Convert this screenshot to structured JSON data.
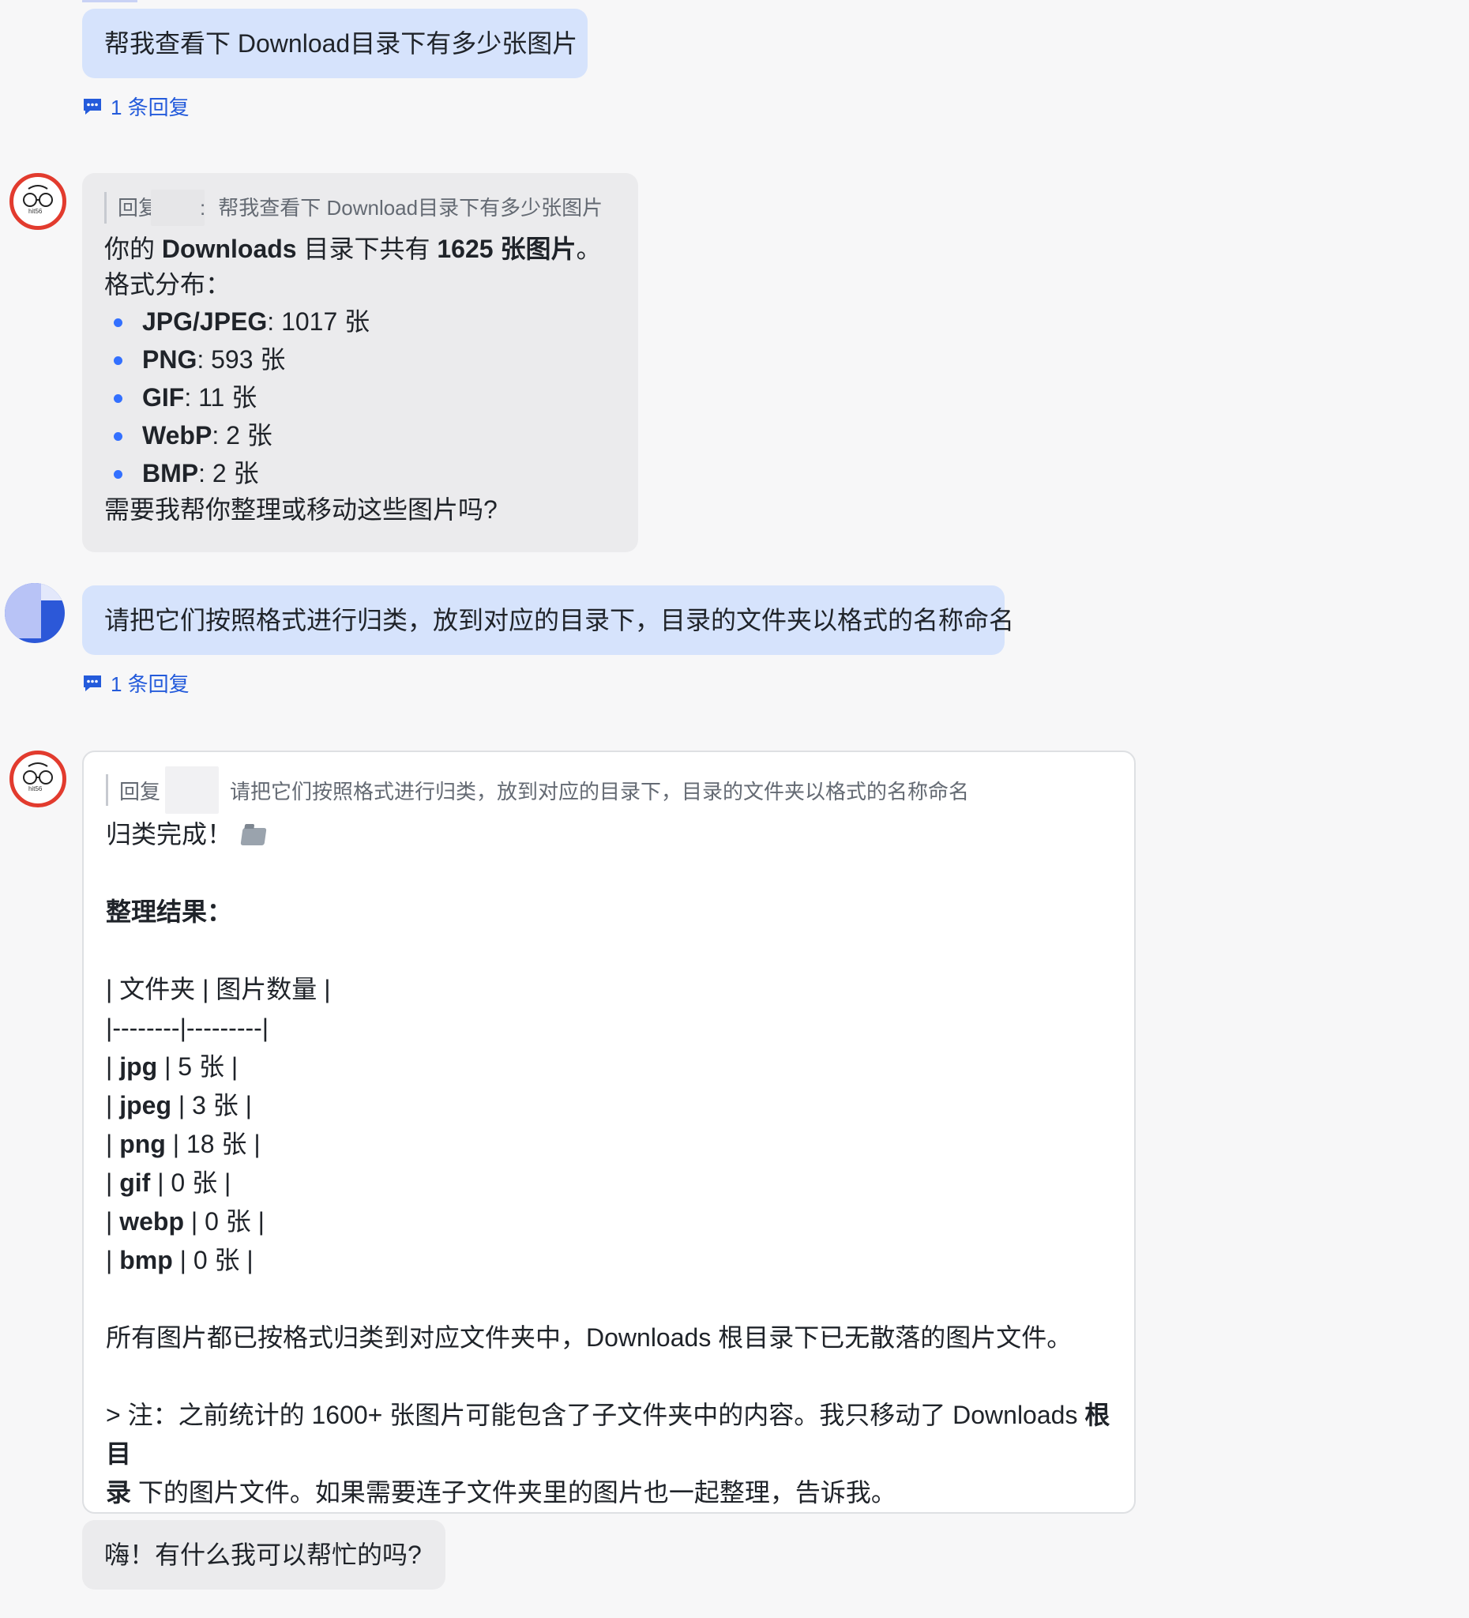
{
  "messages": {
    "m1": {
      "text": "帮我查看下 Download目录下有多少张图片",
      "reply_count": "1 条回复"
    },
    "m2": {
      "avatar_label": "hit56",
      "quote_prefix": "回复",
      "quote_sep": ":",
      "quote_text": "帮我查看下 Download目录下有多少张图片",
      "line1_pre": "你的 ",
      "line1_b1": "Downloads",
      "line1_mid": " 目录下共有 ",
      "line1_b2": "1625 张图片",
      "line1_post": "。",
      "line2": "格式分布：",
      "formats": [
        {
          "name": "JPG/JPEG",
          "count": ": 1017 张"
        },
        {
          "name": "PNG",
          "count": ": 593 张"
        },
        {
          "name": "GIF",
          "count": ": 11 张"
        },
        {
          "name": "WebP",
          "count": ": 2 张"
        },
        {
          "name": "BMP",
          "count": ": 2 张"
        }
      ],
      "closing": "需要我帮你整理或移动这些图片吗?"
    },
    "m3": {
      "text": "请把它们按照格式进行归类，放到对应的目录下，目录的文件夹以格式的名称命名",
      "reply_count": "1 条回复"
    },
    "m4": {
      "avatar_label": "hit56",
      "quote_prefix": "回复",
      "quote_text": "请把它们按照格式进行归类，放到对应的目录下，目录的文件夹以格式的名称命名",
      "done": "归类完成！",
      "folder_icon": "folder-icon",
      "result_title": "整理结果：",
      "table_header": "| 文件夹 | 图片数量 |",
      "table_sep": "|--------|---------|",
      "rows": [
        {
          "pre": "| ",
          "name": "jpg",
          "post": " | 5 张 |"
        },
        {
          "pre": "| ",
          "name": "jpeg",
          "post": " | 3 张 |"
        },
        {
          "pre": "| ",
          "name": "png",
          "post": " | 18 张 |"
        },
        {
          "pre": "| ",
          "name": "gif",
          "post": " | 0 张 |"
        },
        {
          "pre": "| ",
          "name": "webp",
          "post": " | 0 张 |"
        },
        {
          "pre": "| ",
          "name": "bmp",
          "post": " | 0 张 |"
        }
      ],
      "summary": "所有图片都已按格式归类到对应文件夹中，Downloads 根目录下已无散落的图片文件。",
      "note_pre": "> 注：之前统计的 1600+ 张图片可能包含了子文件夹中的内容。我只移动了 Downloads ",
      "note_b1": "根目",
      "note_b2": "录",
      "note_post": " 下的图片文件。如果需要连子文件夹里的图片也一起整理，告诉我。"
    },
    "m5": {
      "text": "嗨！有什么我可以帮忙的吗?"
    }
  },
  "colors": {
    "background": "#f7f7f8",
    "user_bubble": "#d6e3fc",
    "bot_bubble": "#ebebed",
    "link": "#245bdb",
    "bullet": "#3370ff",
    "avatar_ring": "#e23b2e"
  }
}
